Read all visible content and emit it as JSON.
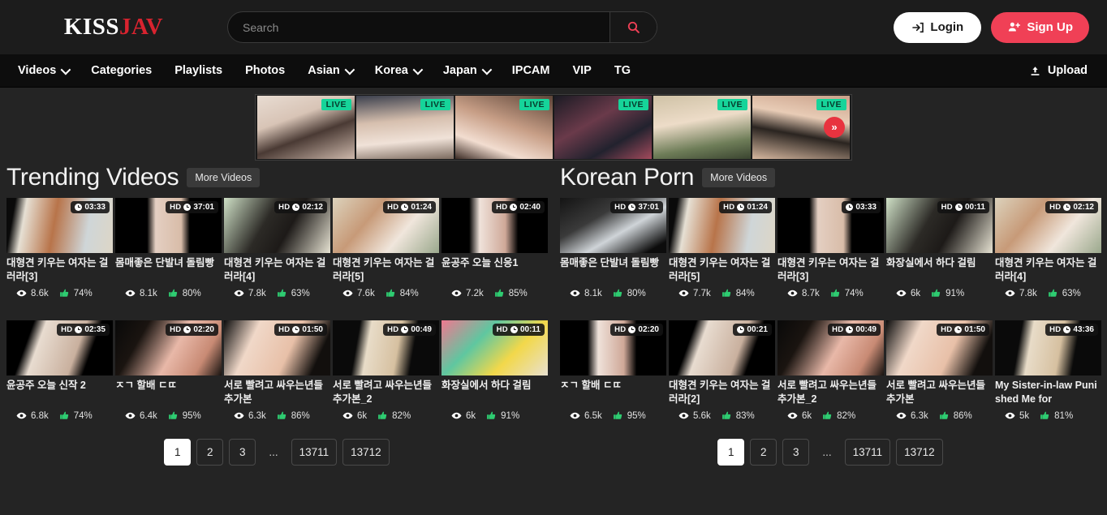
{
  "site": {
    "logo_part1": "KISS",
    "logo_part2": "JAV"
  },
  "header": {
    "search": {
      "value": "",
      "placeholder": "Search"
    },
    "search_icon": "search-icon",
    "login_label": "Login",
    "signup_label": "Sign Up",
    "accent_pink": "#f04056",
    "logo_red": "#d8232f"
  },
  "nav": {
    "items": [
      {
        "label": "Videos",
        "has_dropdown": true
      },
      {
        "label": "Categories",
        "has_dropdown": false
      },
      {
        "label": "Playlists",
        "has_dropdown": false
      },
      {
        "label": "Photos",
        "has_dropdown": false
      },
      {
        "label": "Asian",
        "has_dropdown": true
      },
      {
        "label": "Korea",
        "has_dropdown": true
      },
      {
        "label": "Japan",
        "has_dropdown": true
      },
      {
        "label": "IPCAM",
        "has_dropdown": false
      },
      {
        "label": "VIP",
        "has_dropdown": false
      },
      {
        "label": "TG",
        "has_dropdown": false
      }
    ],
    "upload_label": "Upload"
  },
  "livestrip": {
    "badge_label": "LIVE",
    "badge_color": "#16d49a",
    "next_label": "»",
    "cells": [
      {
        "id": "live-cam-1"
      },
      {
        "id": "live-cam-2"
      },
      {
        "id": "live-cam-3"
      },
      {
        "id": "live-cam-4"
      },
      {
        "id": "live-cam-5"
      },
      {
        "id": "live-cam-6"
      }
    ]
  },
  "sections": [
    {
      "title": "Trending Videos",
      "more_label": "More Videos",
      "rows": [
        [
          {
            "title": "대형견 키우는 여자는 걸러라[3]",
            "hd": "",
            "duration": "03:33",
            "views": "8.6k",
            "rating": "74%"
          },
          {
            "title": "몸매좋은 단발녀 돌림빵",
            "hd": "HD",
            "duration": "37:01",
            "views": "8.1k",
            "rating": "80%"
          },
          {
            "title": "대형견 키우는 여자는 걸러라[4]",
            "hd": "HD",
            "duration": "02:12",
            "views": "7.8k",
            "rating": "63%"
          },
          {
            "title": "대형견 키우는 여자는 걸러라[5]",
            "hd": "HD",
            "duration": "01:24",
            "views": "7.6k",
            "rating": "84%"
          },
          {
            "title": "윤공주 오늘 신응1",
            "hd": "HD",
            "duration": "02:40",
            "views": "7.2k",
            "rating": "85%"
          }
        ],
        [
          {
            "title": "윤공주 오늘 신작 2",
            "hd": "HD",
            "duration": "02:35",
            "views": "6.8k",
            "rating": "74%"
          },
          {
            "title": "ㅈㄱ 할배 ㄷㄸ",
            "hd": "HD",
            "duration": "02:20",
            "views": "6.4k",
            "rating": "95%"
          },
          {
            "title": "서로 빨려고 싸우는년들 추가본",
            "hd": "HD",
            "duration": "01:50",
            "views": "6.3k",
            "rating": "86%"
          },
          {
            "title": "서로 빨려고 싸우는년들 추가본_2",
            "hd": "HD",
            "duration": "00:49",
            "views": "6k",
            "rating": "82%"
          },
          {
            "title": "화장실에서 하다 걸림",
            "hd": "HD",
            "duration": "00:11",
            "views": "6k",
            "rating": "91%"
          }
        ]
      ],
      "pagination": [
        "1",
        "2",
        "3",
        "...",
        "13711",
        "13712"
      ],
      "active_page": "1"
    },
    {
      "title": "Korean Porn",
      "more_label": "More Videos",
      "rows": [
        [
          {
            "title": "몸매좋은 단발녀 돌림빵",
            "hd": "HD",
            "duration": "37:01",
            "views": "8.1k",
            "rating": "80%"
          },
          {
            "title": "대형견 키우는 여자는 걸러라[5]",
            "hd": "HD",
            "duration": "01:24",
            "views": "7.7k",
            "rating": "84%"
          },
          {
            "title": "대형견 키우는 여자는 걸러라[3]",
            "hd": "",
            "duration": "03:33",
            "views": "8.7k",
            "rating": "74%"
          },
          {
            "title": "화장실에서 하다 걸림",
            "hd": "HD",
            "duration": "00:11",
            "views": "6k",
            "rating": "91%"
          },
          {
            "title": "대형견 키우는 여자는 걸러라[4]",
            "hd": "HD",
            "duration": "02:12",
            "views": "7.8k",
            "rating": "63%"
          }
        ],
        [
          {
            "title": "ㅈㄱ 할배 ㄷㄸ",
            "hd": "HD",
            "duration": "02:20",
            "views": "6.5k",
            "rating": "95%"
          },
          {
            "title": "대형견 키우는 여자는 걸러라[2]",
            "hd": "",
            "duration": "00:21",
            "views": "5.6k",
            "rating": "83%"
          },
          {
            "title": "서로 빨려고 싸우는년들 추가본_2",
            "hd": "HD",
            "duration": "00:49",
            "views": "6k",
            "rating": "82%"
          },
          {
            "title": "서로 빨려고 싸우는년들 추가본",
            "hd": "HD",
            "duration": "01:50",
            "views": "6.3k",
            "rating": "86%"
          },
          {
            "title": "My Sister-in-law Punished Me for",
            "hd": "HD",
            "duration": "43:36",
            "views": "5k",
            "rating": "81%"
          }
        ]
      ],
      "pagination": [
        "1",
        "2",
        "3",
        "...",
        "13711",
        "13712"
      ],
      "active_page": "1"
    }
  ]
}
